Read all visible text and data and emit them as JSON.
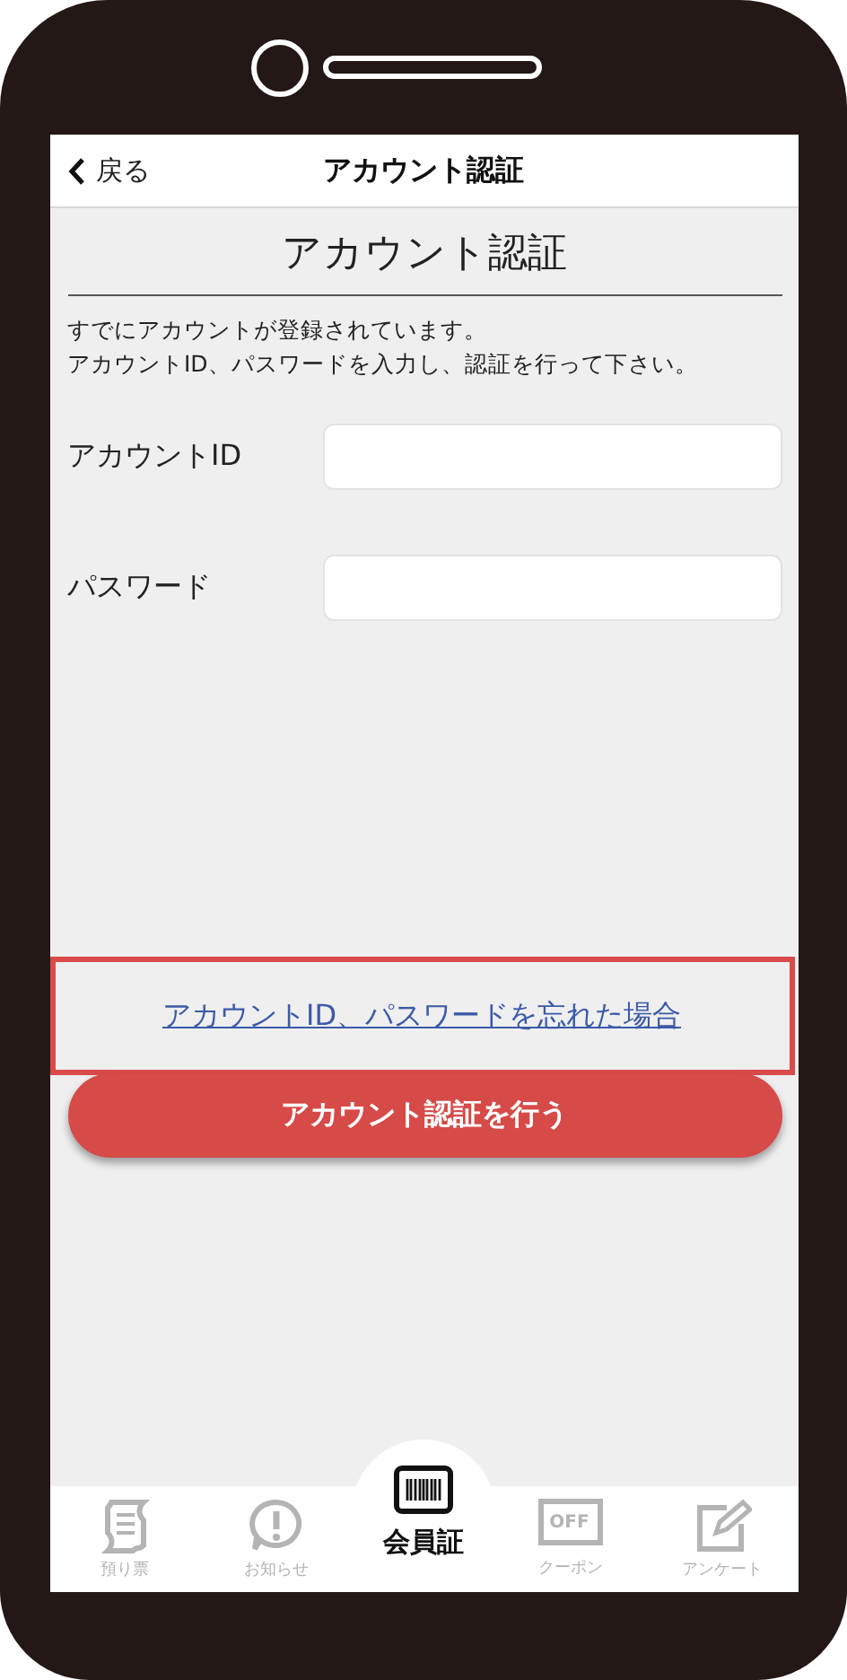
{
  "nav_bar": {
    "back_label": "戻る",
    "title": "アカウント認証"
  },
  "heading": "アカウント認証",
  "description": [
    "すでにアカウントが登録されています。",
    "アカウントID、パスワードを入力し、認証を行って下さい。"
  ],
  "fields": [
    {
      "label": "アカウントID"
    },
    {
      "label": "パスワード"
    }
  ],
  "forgot_link": {
    "text": "アカウントID、パスワードを忘れた場合",
    "highlighted": true
  },
  "submit_button": "アカウント認証を行う",
  "tab_bar": [
    {
      "kind": "receipt",
      "label": "預り票",
      "selected": false
    },
    {
      "kind": "notice",
      "label": "お知らせ",
      "selected": false
    },
    {
      "kind": "barcode",
      "label": "会員証",
      "selected": true
    },
    {
      "kind": "coupon",
      "label": "クーポン",
      "icon_text": "OFF",
      "selected": false
    },
    {
      "kind": "survey",
      "label": "アンケート",
      "selected": false
    }
  ]
}
